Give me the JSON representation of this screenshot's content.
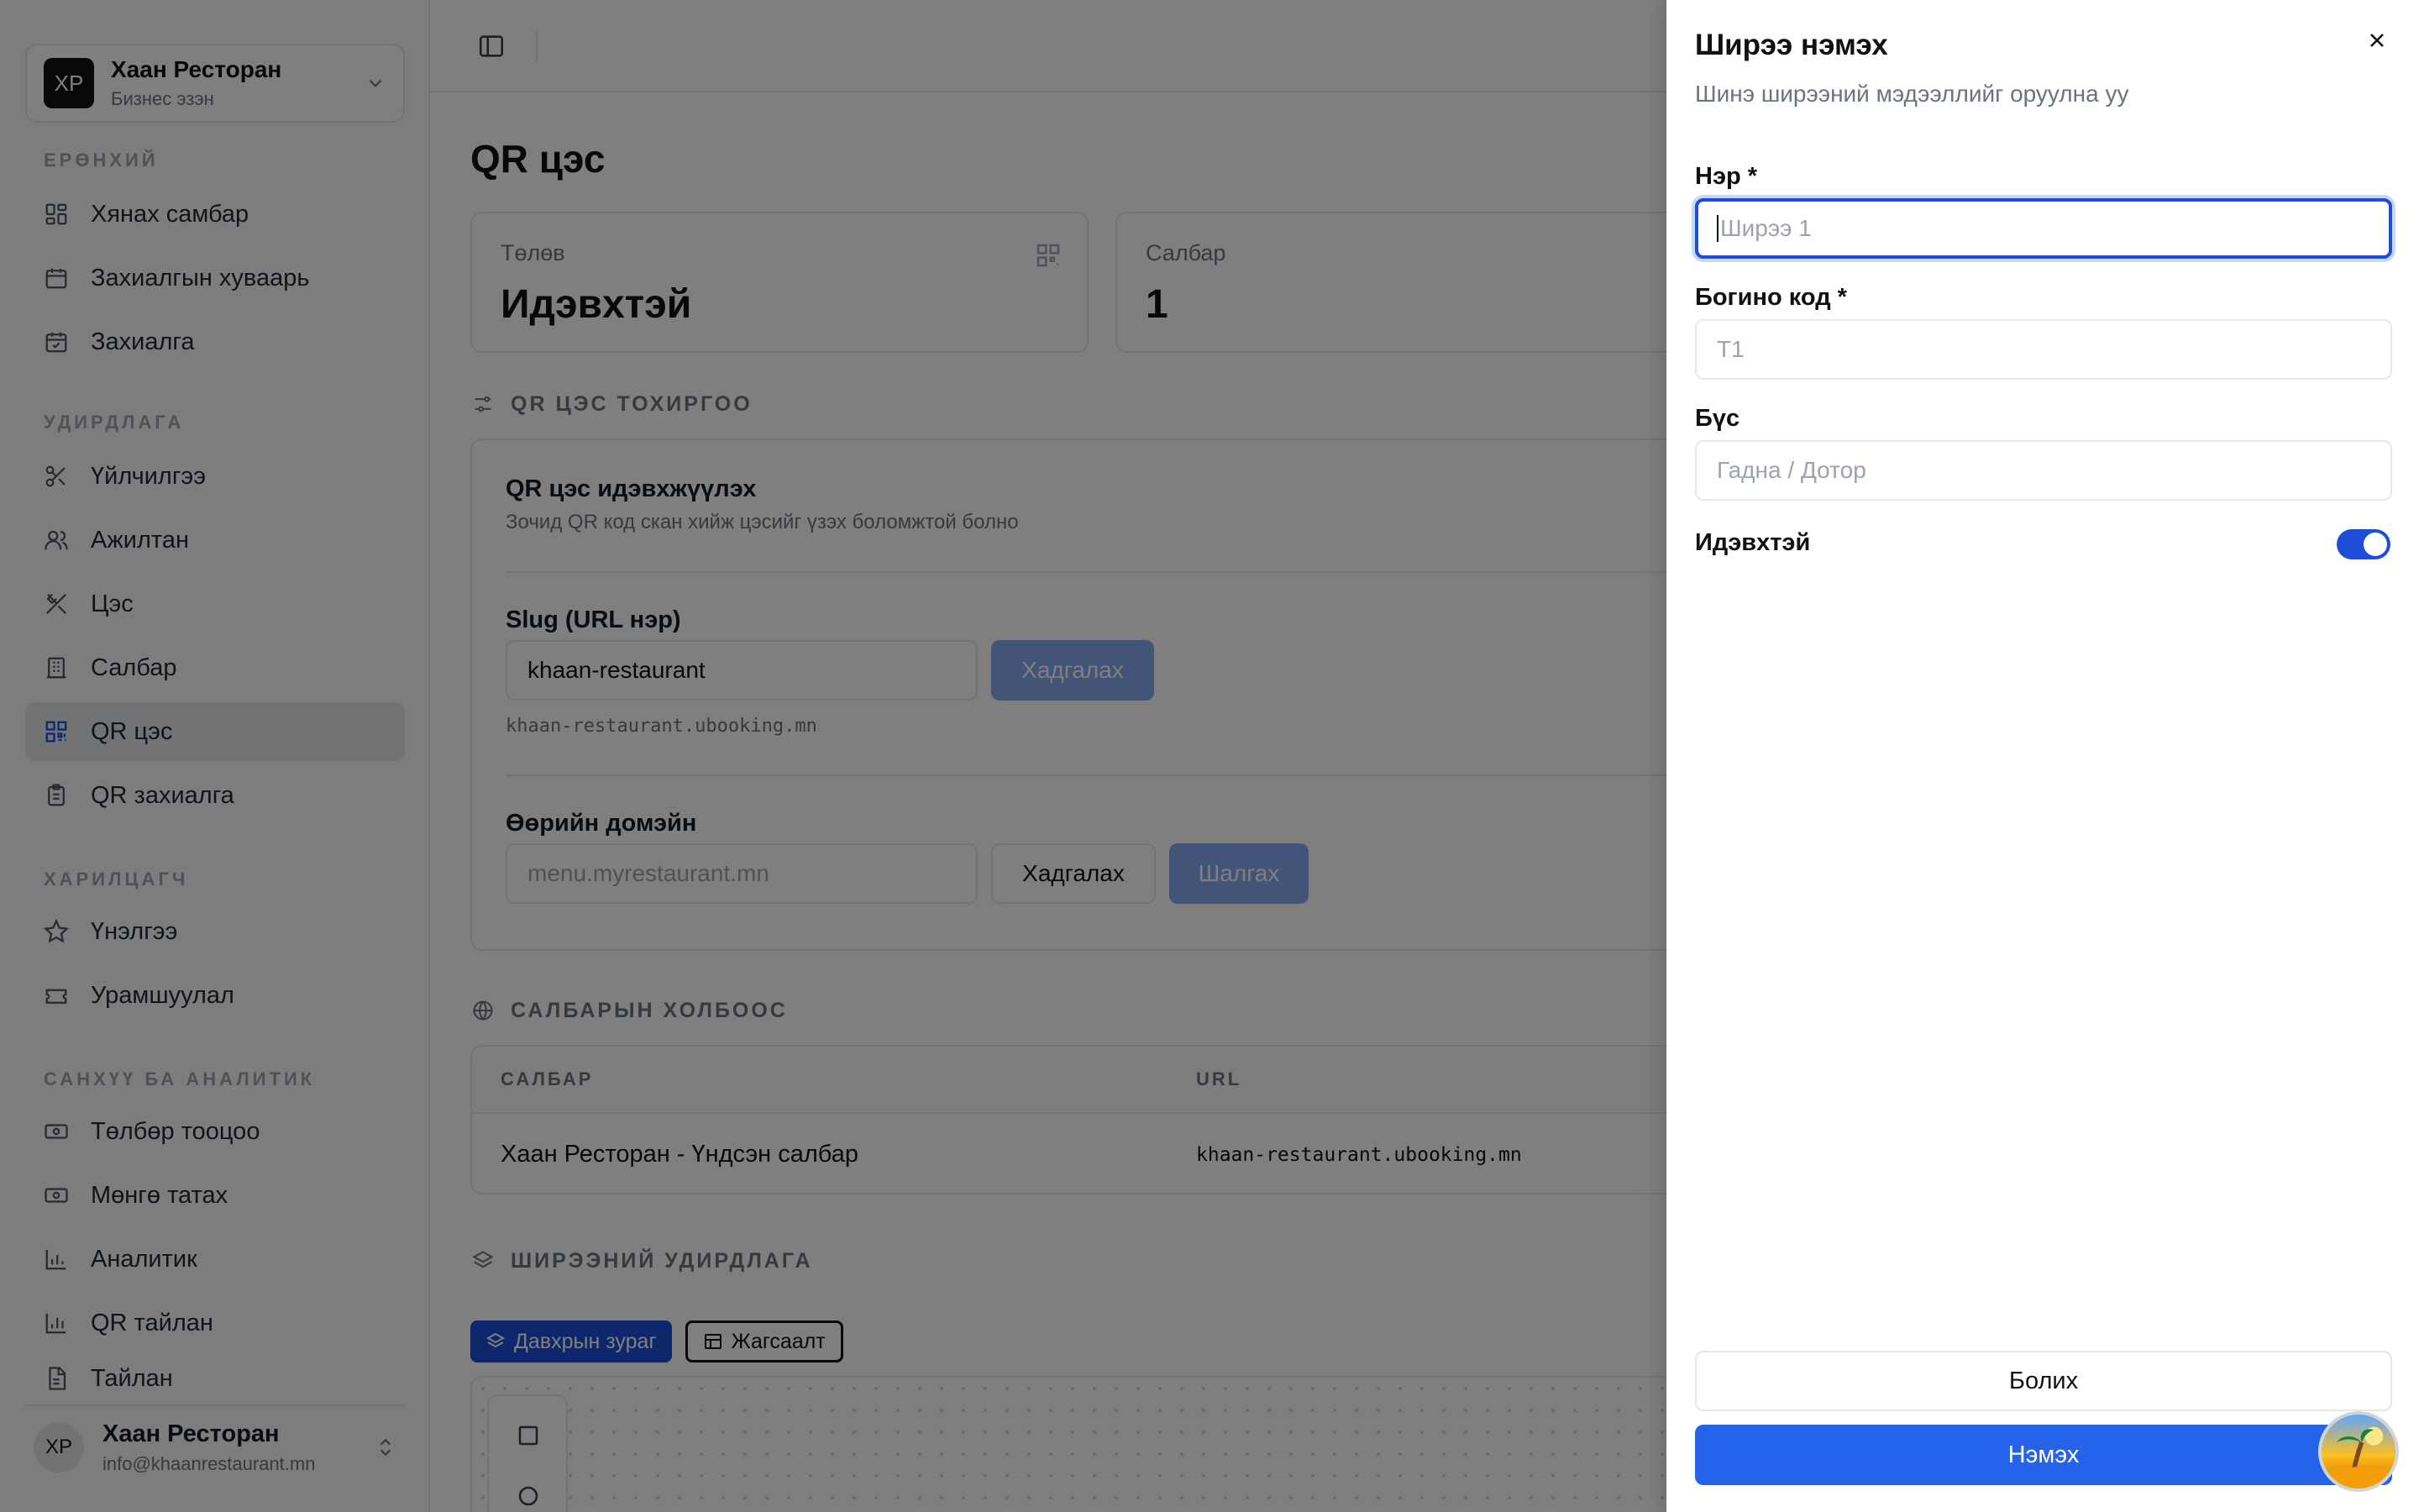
{
  "sidebar": {
    "org": {
      "initials": "XP",
      "name": "Хаан Ресторан",
      "role": "Бизнес эзэн"
    },
    "sections": [
      {
        "label": "ЕРӨНХИЙ"
      },
      {
        "label": "УДИРДЛАГА"
      },
      {
        "label": "ХАРИЛЦАГЧ"
      },
      {
        "label": "САНХҮҮ БА АНАЛИТИК"
      }
    ],
    "items": [
      {
        "label": "Хянах самбар",
        "icon": "dashboard-icon"
      },
      {
        "label": "Захиалгын хуваарь",
        "icon": "calendar-icon"
      },
      {
        "label": "Захиалга",
        "icon": "calendar-check-icon"
      },
      {
        "label": "Үйлчилгээ",
        "icon": "scissors-icon"
      },
      {
        "label": "Ажилтан",
        "icon": "users-icon"
      },
      {
        "label": "Цэс",
        "icon": "utensils-icon"
      },
      {
        "label": "Салбар",
        "icon": "building-icon"
      },
      {
        "label": "QR цэс",
        "icon": "qr-icon",
        "active": true
      },
      {
        "label": "QR захиалга",
        "icon": "clipboard-icon"
      },
      {
        "label": "Үнэлгээ",
        "icon": "star-icon"
      },
      {
        "label": "Урамшуулал",
        "icon": "ticket-icon"
      },
      {
        "label": "Төлбөр тооцоо",
        "icon": "banknote-icon"
      },
      {
        "label": "Мөнгө татах",
        "icon": "wallet-icon"
      },
      {
        "label": "Аналитик",
        "icon": "bar-chart-icon"
      },
      {
        "label": "QR тайлан",
        "icon": "bar-chart-icon"
      },
      {
        "label": "Тайлан",
        "icon": "file-icon"
      }
    ],
    "user": {
      "initials": "XP",
      "name": "Хаан Ресторан",
      "email": "info@khaanrestaurant.mn"
    }
  },
  "main": {
    "title": "QR цэс",
    "stats": [
      {
        "label": "Төлөв",
        "value": "Идэвхтэй"
      },
      {
        "label": "Салбар",
        "value": "1"
      }
    ],
    "config_section": "QR ЦЭС ТОХИРГОО",
    "config": {
      "enable_title": "QR цэс идэвхжүүлэх",
      "enable_desc": "Зочид QR код скан хийж цэсийг үзэх боломжтой болно",
      "slug_label": "Slug (URL нэр)",
      "slug_value": "khaan-restaurant",
      "slug_save": "Хадгалах",
      "slug_hint": "khaan-restaurant.ubooking.mn",
      "domain_label": "Өөрийн домэйн",
      "domain_placeholder": "menu.myrestaurant.mn",
      "domain_save": "Хадгалах",
      "domain_check": "Шалгах"
    },
    "branch_section": "САЛБАРЫН ХОЛБООС",
    "branch_table": {
      "headers": [
        "САЛБАР",
        "URL"
      ],
      "rows": [
        {
          "branch": "Хаан Ресторан - Үндсэн салбар",
          "url": "khaan-restaurant.ubooking.mn"
        }
      ]
    },
    "table_section": "ШИРЭЭНИЙ УДИРДЛАГА",
    "tabs": [
      {
        "label": "Давхрын зураг"
      },
      {
        "label": "Жагсаалт"
      }
    ]
  },
  "drawer": {
    "title": "Ширээ нэмэх",
    "subtitle": "Шинэ ширээний мэдээллийг оруулна уу",
    "name_label": "Нэр *",
    "name_placeholder": "Ширээ 1",
    "code_label": "Богино код *",
    "code_placeholder": "T1",
    "zone_label": "Бүс",
    "zone_placeholder": "Гадна / Дотор",
    "active_label": "Идэвхтэй",
    "active_on": true,
    "cancel": "Болих",
    "submit": "Нэмэх"
  },
  "colors": {
    "accent": "#2563eb",
    "overlay": "rgba(0,0,0,0.5)"
  }
}
